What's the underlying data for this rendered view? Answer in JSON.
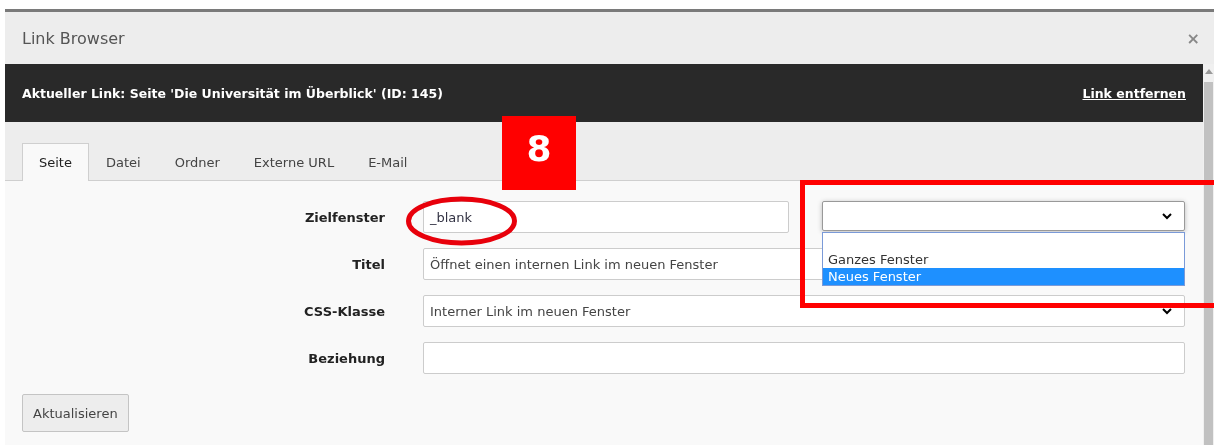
{
  "window": {
    "title": "Link Browser",
    "close": "×"
  },
  "current_link": {
    "text": "Aktueller Link: Seite 'Die Universität im Überblick' (ID: 145)",
    "remove_link": "Link entfernen"
  },
  "tabs": [
    {
      "label": "Seite",
      "selected": true
    },
    {
      "label": "Datei",
      "selected": false
    },
    {
      "label": "Ordner",
      "selected": false
    },
    {
      "label": "Externe URL",
      "selected": false
    },
    {
      "label": "E-Mail",
      "selected": false
    }
  ],
  "form": {
    "target": {
      "label": "Zielfenster",
      "value": "_blank",
      "dropdown": {
        "expanded": true,
        "options": [
          {
            "label": "Ganzes Fenster",
            "selected": false
          },
          {
            "label": "Neues Fenster",
            "selected": true
          }
        ]
      }
    },
    "title": {
      "label": "Titel",
      "value": "Öffnet einen internen Link im neuen Fenster"
    },
    "css_class": {
      "label": "CSS-Klasse",
      "value": "Interner Link im neuen Fenster"
    },
    "relation": {
      "label": "Beziehung"
    }
  },
  "buttons": [
    "Aktualisieren"
  ],
  "annotations": {
    "badge": "8"
  }
}
